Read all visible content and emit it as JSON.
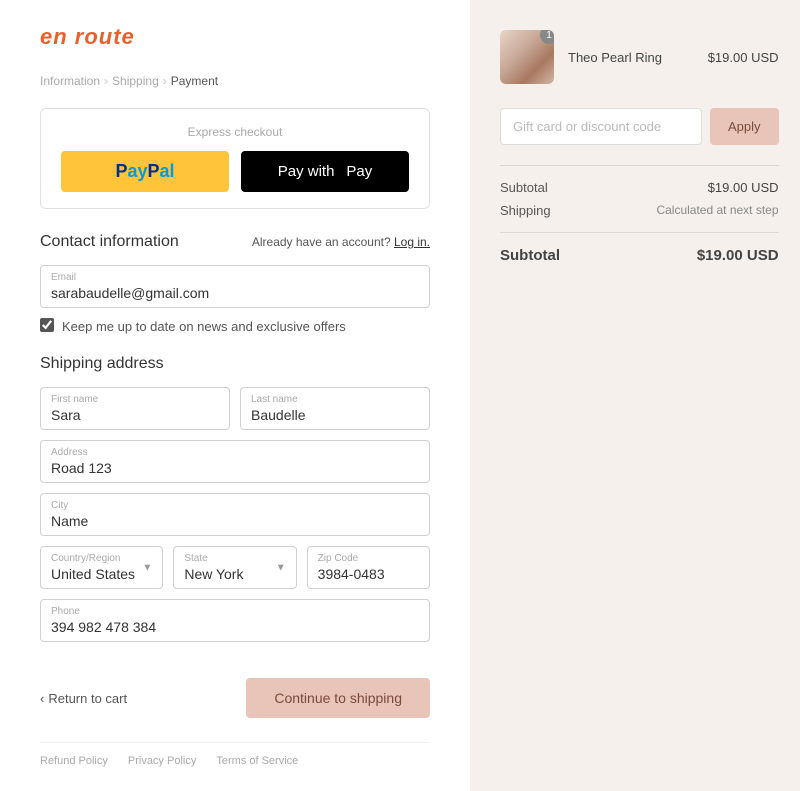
{
  "logo": {
    "text": "en route"
  },
  "breadcrumb": {
    "items": [
      "Information",
      "Shipping",
      "Payment"
    ],
    "active": "Payment"
  },
  "express_checkout": {
    "label": "Express checkout",
    "paypal_label": "PayPal",
    "applepay_label": "Pay with",
    "applepay_suffix": "Pay"
  },
  "contact_section": {
    "title": "Contact information",
    "already_account": "Already have an account?",
    "login_label": "Log in.",
    "email_label": "Email",
    "email_value": "sarabaudelle@gmail.com",
    "checkbox_label": "Keep me up to date on news and exclusive offers"
  },
  "shipping_section": {
    "title": "Shipping address",
    "first_name_label": "First name",
    "first_name_value": "Sara",
    "last_name_label": "Last name",
    "last_name_value": "Baudelle",
    "address_label": "Address",
    "address_value": "Road 123",
    "city_label": "City",
    "city_value": "Name",
    "country_label": "Country/Region",
    "country_value": "United States",
    "state_label": "State",
    "state_value": "New York",
    "zip_label": "Zip Code",
    "zip_value": "3984-0483",
    "phone_label": "Phone",
    "phone_value": "394 982 478 384"
  },
  "actions": {
    "return_label": "Return to cart",
    "continue_label": "Continue to shipping"
  },
  "footer_links": [
    "Refund Policy",
    "Privacy Policy",
    "Terms of Service"
  ],
  "order_summary": {
    "item_name": "Theo Pearl Ring",
    "item_price": "$19.00 USD",
    "item_qty": "1",
    "discount_placeholder": "Gift card or discount code",
    "apply_label": "Apply",
    "subtotal_label": "Subtotal",
    "subtotal_value": "$19.00 USD",
    "shipping_label": "Shipping",
    "shipping_value": "Calculated at next step",
    "total_label": "Subtotal",
    "total_value": "$19.00 USD"
  }
}
